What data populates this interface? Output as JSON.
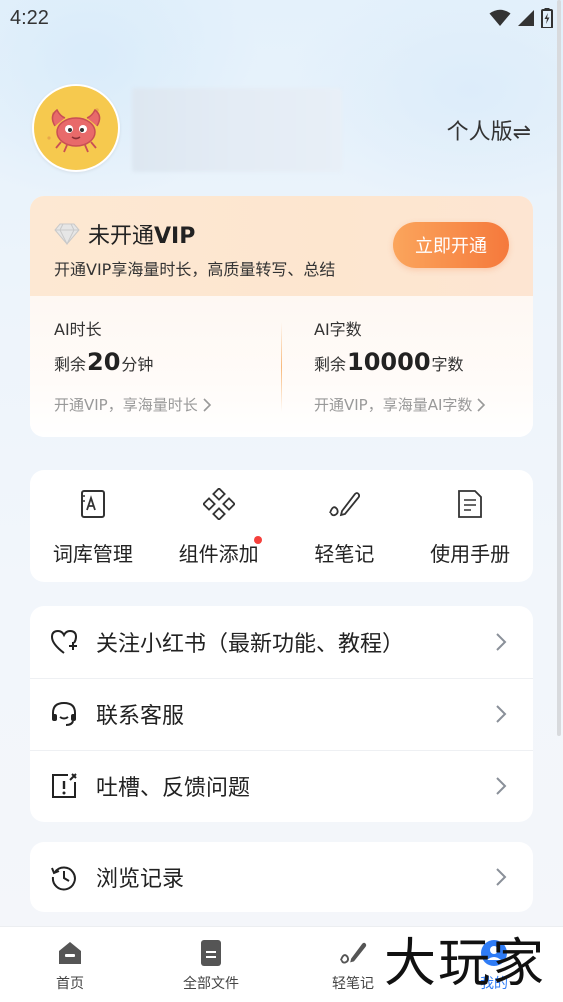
{
  "status_bar": {
    "time": "4:22"
  },
  "profile": {
    "edition_label": "个人版⇌"
  },
  "vip": {
    "title_prefix": "未开通",
    "title_vip": "VIP",
    "subtitle": "开通VIP享海量时长，高质量转写、总结",
    "button_label": "立即开通",
    "quota_time": {
      "label": "AI时长",
      "prefix": "剩余",
      "number": "20",
      "unit": "分钟",
      "link": "开通VIP，享海量时长"
    },
    "quota_words": {
      "label": "AI字数",
      "prefix": "剩余",
      "number": "10000",
      "unit": "字数",
      "link": "开通VIP，享海量AI字数"
    }
  },
  "tools": [
    {
      "label": "词库管理",
      "icon": "lexicon-icon"
    },
    {
      "label": "组件添加",
      "icon": "widgets-icon",
      "badge": true
    },
    {
      "label": "轻笔记",
      "icon": "pen-note-icon"
    },
    {
      "label": "使用手册",
      "icon": "manual-icon"
    }
  ],
  "menu_group_1": [
    {
      "label": "关注小红书（最新功能、教程）",
      "icon": "heart-plus-icon"
    },
    {
      "label": "联系客服",
      "icon": "headset-icon"
    },
    {
      "label": "吐槽、反馈问题",
      "icon": "feedback-icon"
    }
  ],
  "menu_group_2": [
    {
      "label": "浏览记录",
      "icon": "history-icon"
    }
  ],
  "bottom_nav": [
    {
      "label": "首页",
      "icon": "home-icon"
    },
    {
      "label": "全部文件",
      "icon": "file-icon"
    },
    {
      "label": "轻笔记",
      "icon": "pen-note-icon"
    },
    {
      "label": "我的",
      "icon": "profile-icon",
      "active": true
    }
  ],
  "watermark": "大玩家",
  "colors": {
    "accent": "#2f7cf6",
    "vip_orange": "#f5793c",
    "badge_red": "#f5403c"
  }
}
